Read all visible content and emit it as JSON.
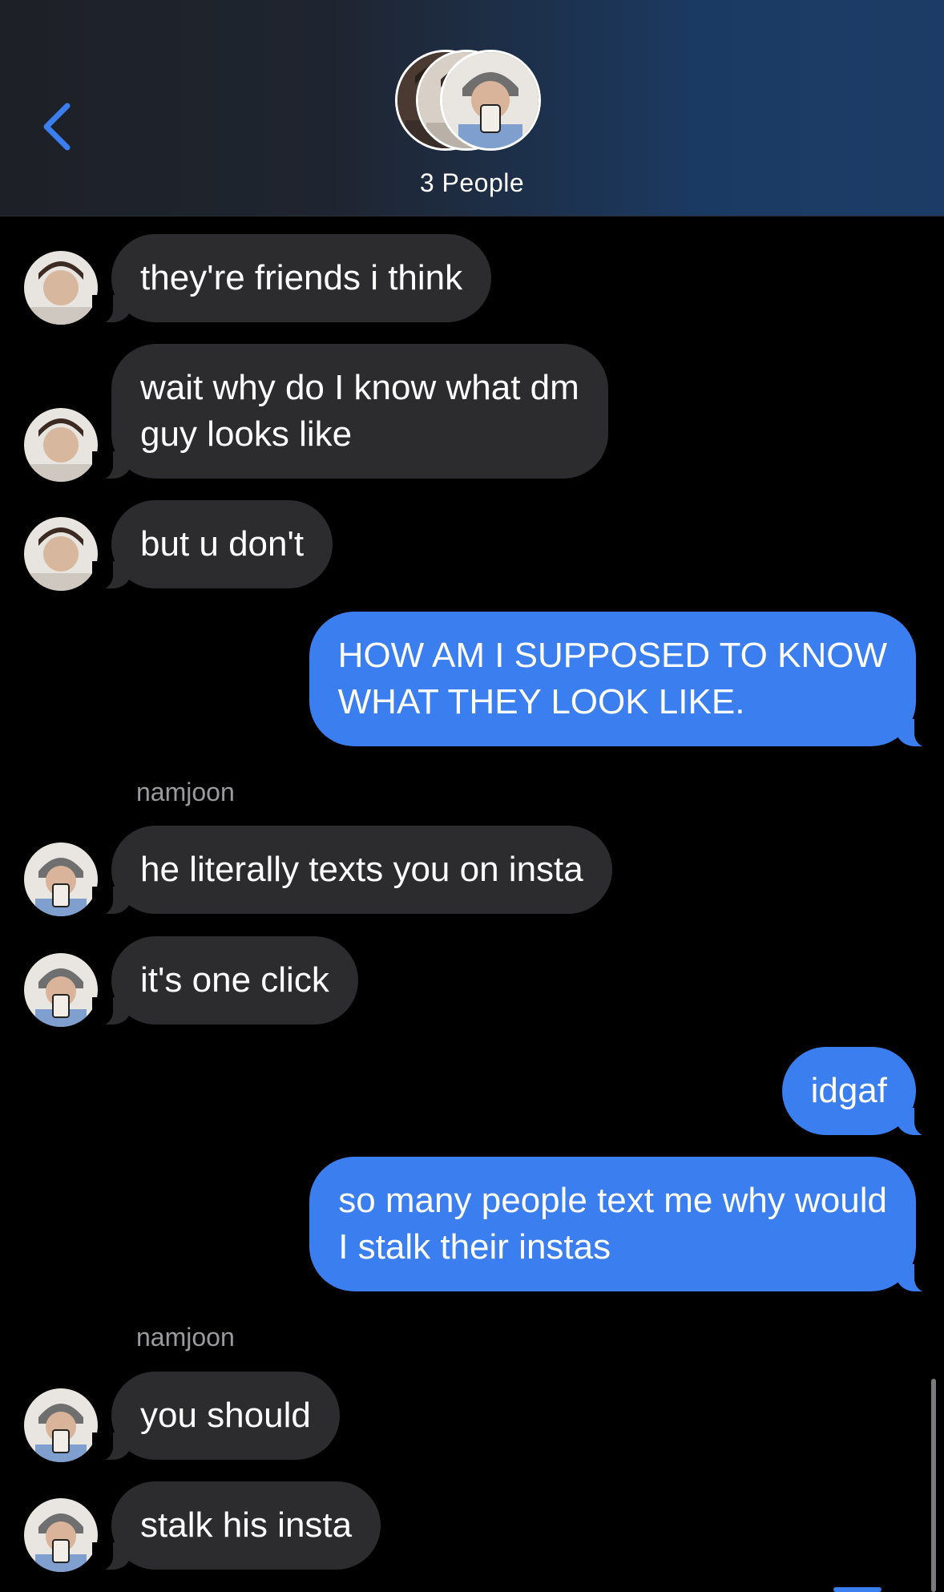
{
  "header": {
    "back_icon": "chevron-left-icon",
    "title": "3 People",
    "accent_color": "#3a7ef0"
  },
  "messages": [
    {
      "id": "m1",
      "dir": "in",
      "avatar": "contact-a",
      "text": "they're friends i think"
    },
    {
      "id": "m2",
      "dir": "in",
      "avatar": "contact-a",
      "text": "wait why do I know what dm\nguy looks like"
    },
    {
      "id": "m3",
      "dir": "in",
      "avatar": "contact-a",
      "text": "but u don't"
    },
    {
      "id": "m4",
      "dir": "out",
      "text": "HOW AM I SUPPOSED TO KNOW\nWHAT THEY LOOK LIKE."
    },
    {
      "id": "s1",
      "sender": "namjoon"
    },
    {
      "id": "m5",
      "dir": "in",
      "avatar": "namjoon",
      "text": "he literally texts you on insta"
    },
    {
      "id": "m6",
      "dir": "in",
      "avatar": "namjoon",
      "text": "it's one click"
    },
    {
      "id": "m7",
      "dir": "out",
      "text": "idgaf"
    },
    {
      "id": "m8",
      "dir": "out",
      "text": "so many people text me why would\nI stalk their instas"
    },
    {
      "id": "s2",
      "sender": "namjoon"
    },
    {
      "id": "m9",
      "dir": "in",
      "avatar": "namjoon",
      "text": "you should"
    },
    {
      "id": "m10",
      "dir": "in",
      "avatar": "namjoon",
      "text": "stalk his insta"
    }
  ],
  "colors": {
    "incoming_bubble": "#2c2c2e",
    "outgoing_bubble": "#3a7ef0",
    "sender_label": "#9a9a9f",
    "background": "#000000"
  }
}
